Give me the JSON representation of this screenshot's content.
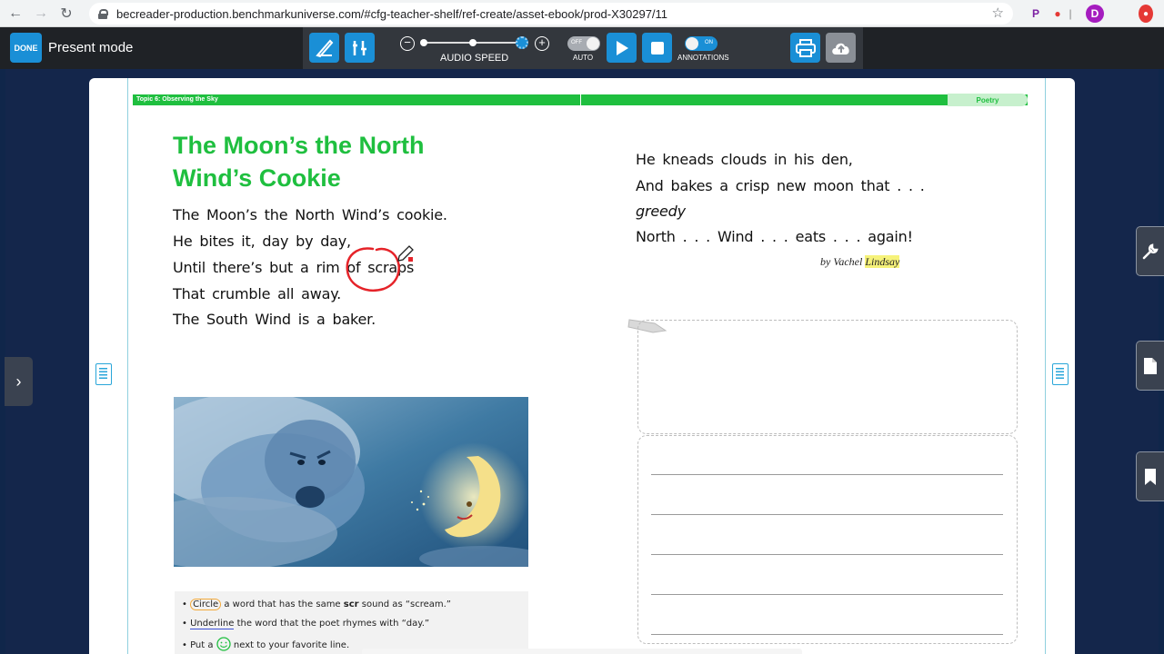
{
  "browser": {
    "url": "becreader-production.benchmarkuniverse.com/#cfg-teacher-shelf/ref-create/asset-ebook/prod-X30297/11",
    "avatar_letter": "D"
  },
  "toolbar": {
    "done_label": "DONE",
    "mode_label": "Present mode",
    "audio_speed_label": "AUDIO SPEED",
    "auto_toggle_state": "OFF",
    "auto_label": "AUTO",
    "annotations_toggle_state": "ON",
    "annotations_label": "ANNOTATIONS",
    "minus_label": "−",
    "plus_label": "+"
  },
  "page": {
    "topic": "Topic 6: Observing the Sky",
    "section": "Poetry",
    "title_line1": "The Moon’s the North",
    "title_line2": "Wind’s Cookie",
    "poem_left": [
      "The Moon’s the North Wind’s cookie.",
      "He bites it, day by day,",
      "Until there’s but a rim of scraps",
      "That crumble all away.",
      "The South Wind is a baker."
    ],
    "poem_right": [
      "He kneads clouds in his den,",
      "And bakes a crisp new moon that . . .",
      "greedy",
      "North . . . Wind . . . eats . . . again!"
    ],
    "byline_prefix": "by Vachel",
    "byline_highlight": "Lindsay",
    "instructions": {
      "line1_circle_word": "Circle",
      "line1_rest_a": "a word that has the same",
      "line1_bold": "scr",
      "line1_rest_b": "sound as “scream.”",
      "line2_underline_word": "Underline",
      "line2_rest": "the word that the poet rhymes with “day.”",
      "line3_prefix": "Put a",
      "line3_rest": "next to your favorite line."
    }
  },
  "colors": {
    "brand_blue": "#1a8fd6",
    "topic_green": "#1fbf3f",
    "annotation_red": "#e52329",
    "highlight_yellow": "#f6f27a"
  }
}
